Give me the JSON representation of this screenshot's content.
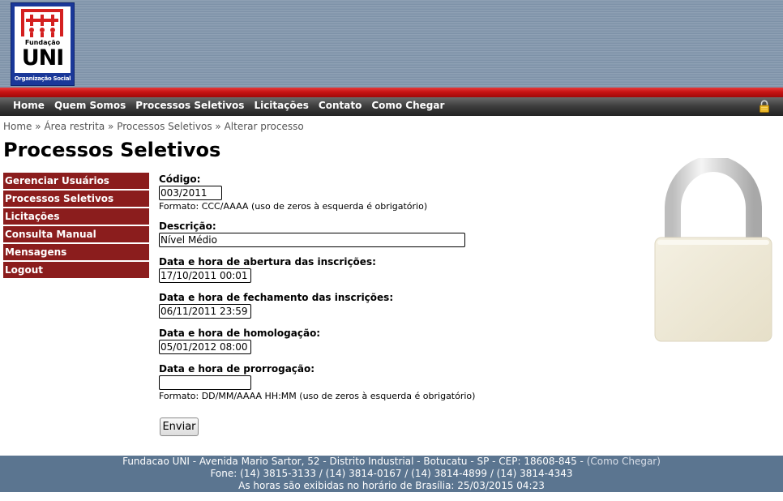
{
  "logo": {
    "top_text": "Fundação",
    "main_text": "UNI",
    "sub_text": "Organização Social"
  },
  "nav": {
    "items": [
      "Home",
      "Quem Somos",
      "Processos Seletivos",
      "Licitações",
      "Contato",
      "Como Chegar"
    ],
    "lock_icon": "lock-icon"
  },
  "breadcrumb": {
    "items": [
      "Home",
      "Área restrita",
      "Processos Seletivos",
      "Alterar processo"
    ],
    "separator": "»"
  },
  "page_title": "Processos Seletivos",
  "sidebar": {
    "items": [
      "Gerenciar Usuários",
      "Processos Seletivos",
      "Licitações",
      "Consulta Manual",
      "Mensagens",
      "Logout"
    ],
    "color": "#8b1d1d"
  },
  "form": {
    "codigo": {
      "label": "Código:",
      "value": "003/2011",
      "hint": "Formato: CCC/AAAA (uso de zeros à esquerda é obrigatório)"
    },
    "descricao": {
      "label": "Descrição:",
      "value": "Nível Médio"
    },
    "abertura": {
      "label": "Data e hora de abertura das inscrições:",
      "value": "17/10/2011 00:01"
    },
    "fechamento": {
      "label": "Data e hora de fechamento das inscrições:",
      "value": "06/11/2011 23:59"
    },
    "homologacao": {
      "label": "Data e hora de homologação:",
      "value": "05/01/2012 08:00"
    },
    "prorrogacao": {
      "label": "Data e hora de prorrogação:",
      "value": "",
      "hint": "Formato: DD/MM/AAAA HH:MM (uso de zeros à esquerda é obrigatório)"
    },
    "submit_label": "Enviar"
  },
  "footer": {
    "line1": "Fundacao UNI - Avenida Mario Sartor, 52 - Distrito Industrial - Botucatu - SP - CEP: 18608-845 -",
    "line1_link": "(Como Chegar)",
    "line2": "Fone: (14) 3815-3133 / (14) 3814-0167 / (14) 3814-4899 / (14) 3814-4343",
    "line3": "As horas são exibidas no horário de Brasília: 25/03/2015 04:23"
  },
  "colors": {
    "header": "#7e92a8",
    "redbar": "#c81414",
    "nav": "#3c3c3c",
    "footer": "#5b7590"
  }
}
